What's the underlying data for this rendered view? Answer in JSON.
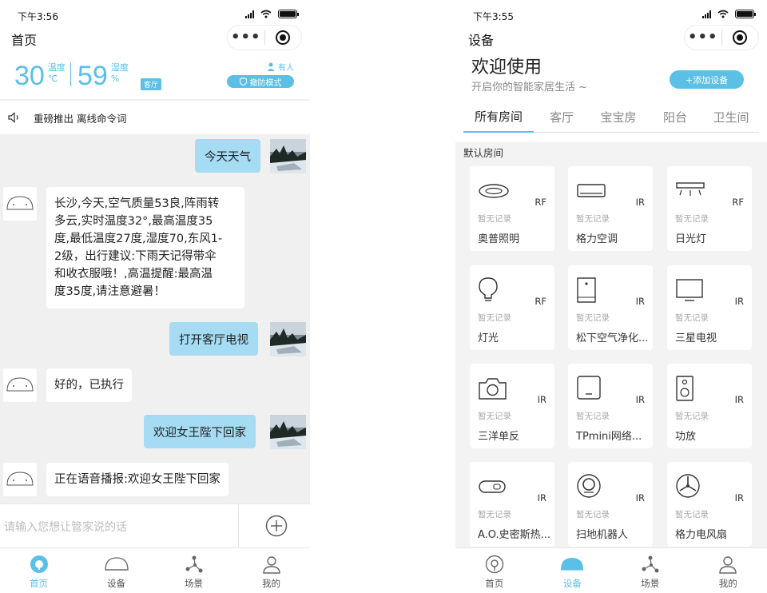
{
  "left": {
    "status": {
      "time": "下午3:56"
    },
    "title": "首页",
    "capsule": {
      "more": "•••"
    },
    "sensors": {
      "temperature": {
        "value": "30",
        "label": "温度",
        "unit": "℃"
      },
      "humidity": {
        "value": "59",
        "label": "湿度",
        "unit": "%"
      },
      "room": "客厅",
      "presence": "有人",
      "arm_mode": "撤防模式"
    },
    "notice": "重磅推出  离线命令词",
    "messages": [
      {
        "from": "user",
        "text": "今天天气"
      },
      {
        "from": "bot",
        "lines": [
          "长沙,今天,空气质量53良,阵雨转",
          "多云,实时温度32°,最高温度35",
          "度,最低温度27度,湿度70,东风1-",
          "2级，出行建议:下雨天记得带伞",
          "和收衣服哦！,高温提醒:最高温",
          "度35度,请注意避暑！"
        ]
      },
      {
        "from": "user",
        "text": "打开客厅电视"
      },
      {
        "from": "bot",
        "text": "好的，已执行"
      },
      {
        "from": "user",
        "text": "欢迎女王陛下回家"
      },
      {
        "from": "bot",
        "text": "正在语音播报:欢迎女王陛下回家"
      }
    ],
    "input_placeholder": "请输入您想让管家说的话",
    "tabs": [
      {
        "label": "首页",
        "active": true
      },
      {
        "label": "设备",
        "active": false
      },
      {
        "label": "场景",
        "active": false
      },
      {
        "label": "我的",
        "active": false
      }
    ]
  },
  "right": {
    "status": {
      "time": "下午3:55"
    },
    "title": "设备",
    "capsule": {
      "more": "•••"
    },
    "welcome": "欢迎使用",
    "subtitle": "开启你的智能家居生活 ~",
    "add_button": "+添加设备",
    "room_tabs": [
      {
        "label": "所有房间",
        "active": true
      },
      {
        "label": "客厅",
        "active": false
      },
      {
        "label": "宝宝房",
        "active": false
      },
      {
        "label": "阳台",
        "active": false
      },
      {
        "label": "卫生间",
        "active": false
      }
    ],
    "section_label": "默认房间",
    "devices": [
      {
        "name": "奥普照明",
        "protocol": "RF",
        "record": "暂无记录",
        "icon": "ceiling-light-icon"
      },
      {
        "name": "格力空调",
        "protocol": "IR",
        "record": "暂无记录",
        "icon": "air-conditioner-icon"
      },
      {
        "name": "日光灯",
        "protocol": "RF",
        "record": "暂无记录",
        "icon": "fluorescent-light-icon"
      },
      {
        "name": "灯光",
        "protocol": "RF",
        "record": "暂无记录",
        "icon": "bulb-icon"
      },
      {
        "name": "松下空气净化...",
        "protocol": "IR",
        "record": "暂无记录",
        "icon": "air-purifier-icon"
      },
      {
        "name": "三星电视",
        "protocol": "IR",
        "record": "暂无记录",
        "icon": "tv-icon"
      },
      {
        "name": "三洋单反",
        "protocol": "IR",
        "record": "暂无记录",
        "icon": "camera-icon"
      },
      {
        "name": "TPmini网络...",
        "protocol": "IR",
        "record": "暂无记录",
        "icon": "set-top-box-icon"
      },
      {
        "name": "功放",
        "protocol": "IR",
        "record": "暂无记录",
        "icon": "speaker-icon"
      },
      {
        "name": "A.O.史密斯热...",
        "protocol": "IR",
        "record": "暂无记录",
        "icon": "water-heater-icon"
      },
      {
        "name": "扫地机器人",
        "protocol": "IR",
        "record": "暂无记录",
        "icon": "robot-vacuum-icon"
      },
      {
        "name": "格力电风扇",
        "protocol": "IR",
        "record": "暂无记录",
        "icon": "fan-icon"
      }
    ],
    "tabs": [
      {
        "label": "首页",
        "active": false
      },
      {
        "label": "设备",
        "active": true
      },
      {
        "label": "场景",
        "active": false
      },
      {
        "label": "我的",
        "active": false
      }
    ]
  },
  "colors": {
    "accent": "#5bbfe6",
    "user_bubble": "#a6dcf3",
    "chat_bg": "#f0f0f0"
  }
}
